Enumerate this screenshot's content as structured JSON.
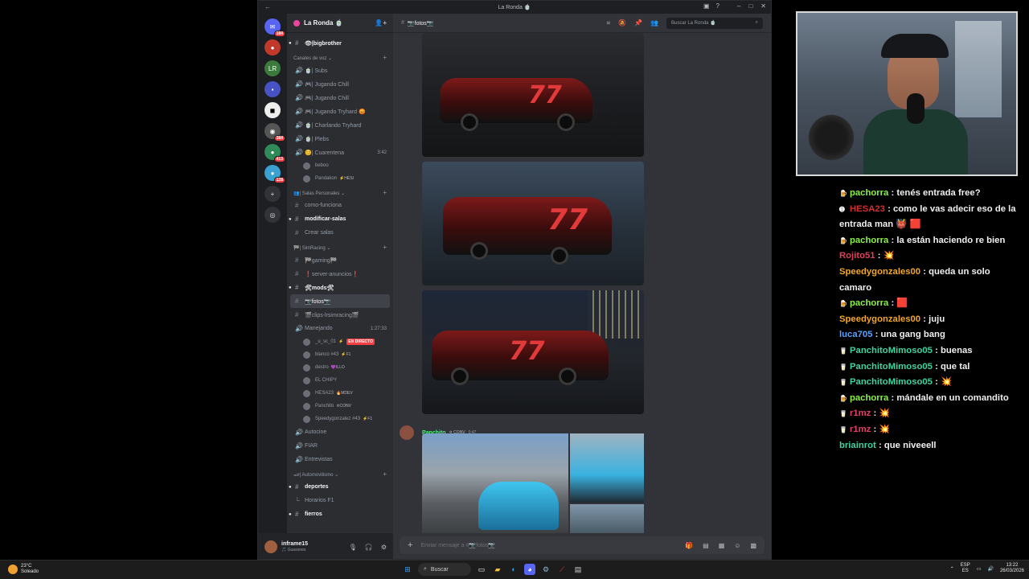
{
  "discord": {
    "window_title": "La Ronda 🍵",
    "guild_name": "La Ronda 🍵",
    "current_channel": "📷fotos📷",
    "search_placeholder": "Buscar La Ronda 🍵",
    "server_badges": [
      "184",
      "384",
      "413",
      "128"
    ],
    "channels": [
      {
        "kind": "text",
        "name": "👁|bigbrother",
        "bold": true,
        "bullet": true
      },
      {
        "kind": "category",
        "name": "Canales de voz ⌄"
      },
      {
        "kind": "voice",
        "name": "🍵| Subs"
      },
      {
        "kind": "voice",
        "name": "🎮| Jugando Chill"
      },
      {
        "kind": "voice",
        "name": "🎮| Jugando Chill"
      },
      {
        "kind": "voice",
        "name": "🎮| Jugando Tryhard 😡"
      },
      {
        "kind": "voice",
        "name": "🍵| Charlando Tryhard"
      },
      {
        "kind": "voice",
        "name": "🍵| Plebs"
      },
      {
        "kind": "voice",
        "name": "😊| Cuarentena",
        "right": "3:42"
      },
      {
        "kind": "user",
        "name": "beboo"
      },
      {
        "kind": "user",
        "name": "Pandakon",
        "tag": "⚡HESI"
      },
      {
        "kind": "category",
        "name": "👥| Salas Personales ⌄"
      },
      {
        "kind": "text",
        "name": "como-funciona"
      },
      {
        "kind": "text",
        "name": "modificar-salas",
        "bold": true,
        "bullet": true
      },
      {
        "kind": "text",
        "name": "Crear salas"
      },
      {
        "kind": "category",
        "name": "🏁| SimRacing ⌄"
      },
      {
        "kind": "text",
        "name": "🏁gaming🏁"
      },
      {
        "kind": "text",
        "name": "❗server-anuncios❗"
      },
      {
        "kind": "text",
        "name": "🛠mods🛠",
        "bold": true,
        "bullet": true
      },
      {
        "kind": "text",
        "name": "📷fotos📷",
        "selected": true
      },
      {
        "kind": "text",
        "name": "🎬clips-lrsimracing🎬"
      },
      {
        "kind": "voice",
        "name": "Manejando",
        "right": "1:27:33"
      },
      {
        "kind": "user",
        "name": "_u_sc_01",
        "tag": "⚡",
        "live": "EN DIRECTO"
      },
      {
        "kind": "user",
        "name": "blanco #43",
        "tag": "⚡F1"
      },
      {
        "kind": "user",
        "name": "destro",
        "tag": "💜ILLO"
      },
      {
        "kind": "user",
        "name": "EL CHIPY"
      },
      {
        "kind": "user",
        "name": "HESA23",
        "tag": "🔥MDEV"
      },
      {
        "kind": "user",
        "name": "Panchito",
        "tag": "✡CONV"
      },
      {
        "kind": "user",
        "name": "Speedygonzalez #43",
        "tag": "⚡F1"
      },
      {
        "kind": "voice",
        "name": "Autocine"
      },
      {
        "kind": "voice",
        "name": "FIAR"
      },
      {
        "kind": "voice",
        "name": "Entrevistas"
      },
      {
        "kind": "category",
        "name": "🏎| Automovilismo ⌄"
      },
      {
        "kind": "text",
        "name": "deportes",
        "bold": true,
        "bullet": true
      },
      {
        "kind": "thread",
        "name": "Horarios F1"
      },
      {
        "kind": "text",
        "name": "fierros",
        "bold": true,
        "bullet": true
      }
    ],
    "user": {
      "name": "inframe15",
      "status": "🎵 Guasones"
    },
    "message": {
      "author": "Panchito",
      "tag": "✡ CONV",
      "time": "0:47"
    },
    "composer_placeholder": "Enviar mensaje a #📷fotos📷"
  },
  "chat": [
    {
      "icon": "🍺",
      "user": "pachorra",
      "color": "#8bf048",
      "text": ": tenés entrada free?"
    },
    {
      "icon": "➊",
      "user": "HESA23",
      "color": "#d92d2d",
      "text": ": como le vas adecir eso de la entrada man 👹 🟥"
    },
    {
      "icon": "🍺",
      "user": "pachorra",
      "color": "#8bf048",
      "text": ": la están haciendo re bien"
    },
    {
      "icon": "",
      "user": "Rojito51",
      "color": "#e0405a",
      "text": ": 💥"
    },
    {
      "icon": "",
      "user": "Speedygonzales00",
      "color": "#f5a623",
      "text": ": queda un solo camaro"
    },
    {
      "icon": "🍺",
      "user": "pachorra",
      "color": "#8bf048",
      "text": ": 🟥"
    },
    {
      "icon": "",
      "user": "Speedygonzales00",
      "color": "#f5a623",
      "text": ": juju"
    },
    {
      "icon": "",
      "user": "luca705",
      "color": "#5aa0ff",
      "text": ": una gang bang"
    },
    {
      "icon": "🥛",
      "user": "PanchitoMimoso05",
      "color": "#3fd3a0",
      "text": ": buenas"
    },
    {
      "icon": "🥛",
      "user": "PanchitoMimoso05",
      "color": "#3fd3a0",
      "text": ": que tal"
    },
    {
      "icon": "🥛",
      "user": "PanchitoMimoso05",
      "color": "#3fd3a0",
      "text": ": 💥"
    },
    {
      "icon": "🍺",
      "user": "pachorra",
      "color": "#8bf048",
      "text": ": mándale en un comandito"
    },
    {
      "icon": "🥛",
      "user": "r1mz",
      "color": "#e0406a",
      "text": ": 💥"
    },
    {
      "icon": "🥛",
      "user": "r1mz",
      "color": "#e0406a",
      "text": ": 💥"
    },
    {
      "icon": "",
      "user": "briainrot",
      "color": "#3fd3a0",
      "text": ": que niveeell"
    }
  ],
  "taskbar": {
    "weather_temp": "23°C",
    "weather_desc": "Soleado",
    "search_label": "Buscar",
    "lang_top": "ESP",
    "lang_bottom": "ES",
    "time": "13:22",
    "date": "26/03/2026"
  }
}
